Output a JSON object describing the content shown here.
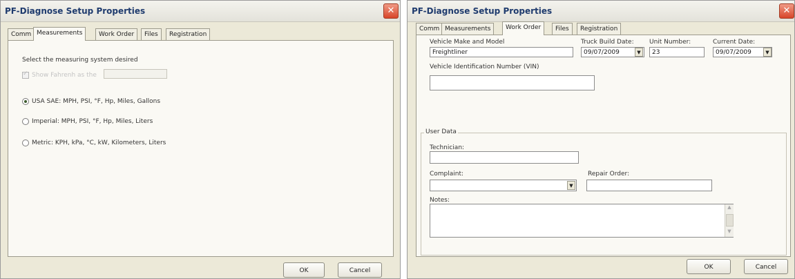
{
  "left_dialog": {
    "title": "PF-Diagnose Setup Properties",
    "close_glyph": "✕",
    "tabs": [
      "Comm",
      "Measurements",
      "Work Order",
      "Files",
      "Registration"
    ],
    "active_tab": "Measurements",
    "prompt": "Select the measuring system desired",
    "disabled_option_label": "Show Fahrenh as the",
    "options": [
      {
        "label": "USA SAE: MPH, PSI, °F, Hp, Miles, Gallons",
        "selected": true
      },
      {
        "label": "Imperial: MPH, PSI, °F, Hp, Miles, Liters",
        "selected": false
      },
      {
        "label": "Metric: KPH, kPa, °C, kW, Kilometers, Liters",
        "selected": false
      }
    ],
    "ok_label": "OK",
    "cancel_label": "Cancel"
  },
  "right_dialog": {
    "title": "PF-Diagnose Setup Properties",
    "close_glyph": "✕",
    "tabs": [
      "Comm",
      "Measurements",
      "Work Order",
      "Files",
      "Registration"
    ],
    "active_tab": "Work Order",
    "vehicle_make_label": "Vehicle Make and Model",
    "vehicle_make_value": "Freightliner",
    "truck_build_date_label": "Truck Build Date:",
    "truck_build_date_value": "09/07/2009",
    "unit_number_label": "Unit Number:",
    "unit_number_value": "23",
    "current_date_label": "Current Date:",
    "current_date_value": "09/07/2009",
    "vin_label": "Vehicle Identification Number (VIN)",
    "vin_value": "",
    "user_data_label": "User Data",
    "technician_label": "Technician:",
    "technician_value": "",
    "complaint_label": "Complaint:",
    "complaint_value": "",
    "repair_order_label": "Repair Order:",
    "repair_order_value": "",
    "notes_label": "Notes:",
    "notes_value": "",
    "dropdown_glyph": "▼",
    "ok_label": "OK",
    "cancel_label": "Cancel"
  }
}
